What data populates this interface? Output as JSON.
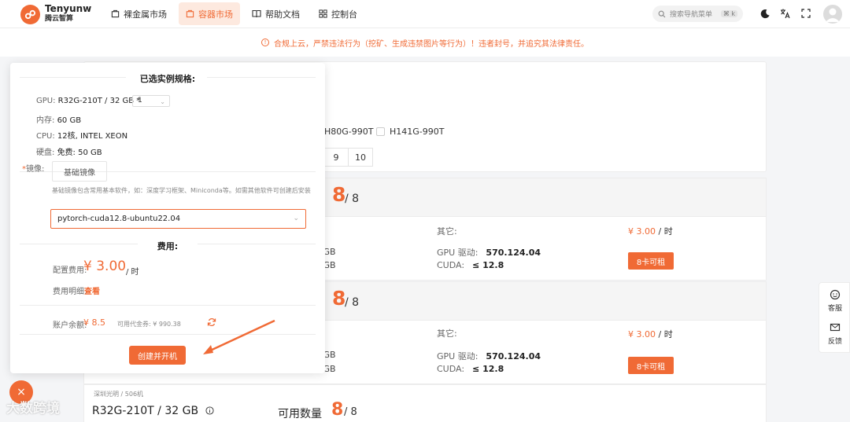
{
  "header": {
    "brand_en": "Tenyunw",
    "brand_cn": "腾云智算",
    "nav": [
      {
        "label": "裸金属市场",
        "icon": "shop-icon"
      },
      {
        "label": "容器市场",
        "icon": "container-icon",
        "active": true
      },
      {
        "label": "帮助文档",
        "icon": "book-icon"
      },
      {
        "label": "控制台",
        "icon": "console-icon"
      }
    ],
    "search_placeholder": "搜索导航菜单",
    "search_shortcut": "⌘ k"
  },
  "notice": "合规上云，严禁违法行为（挖矿、生成违禁图片等行为）！违者封号，并追究其法律责任。",
  "filters": {
    "gpu_options": [
      "H80G-990T",
      "H141G-990T"
    ],
    "pages": [
      "9",
      "10"
    ]
  },
  "listings": [
    {
      "avail_num": "8",
      "avail_den": "/ 8",
      "other_label": "其它:",
      "mem_a": "0 GB",
      "mem_b": "0 GB",
      "driver_label": "GPU 驱动:",
      "driver": "570.124.04",
      "cuda_label": "CUDA:",
      "cuda": "≤ 12.8",
      "price": "¥ 3.00",
      "price_unit": "/ 时",
      "rent": "8卡可租"
    },
    {
      "avail_num": "8",
      "avail_den": "/ 8",
      "other_label": "其它:",
      "mem_a": "0 GB",
      "mem_b": "0 GB",
      "driver_label": "GPU 驱动:",
      "driver": "570.124.04",
      "cuda_label": "CUDA:",
      "cuda": "≤ 12.8",
      "price": "¥ 3.00",
      "price_unit": "/ 时",
      "rent": "8卡可租"
    }
  ],
  "bottom_listing": {
    "sub": "深圳光明 / 506机",
    "title": "R32G-210T / 32 GB",
    "avail_label": "可用数量",
    "avail_num": "8",
    "avail_den": "/ 8"
  },
  "side_float": {
    "service": "客服",
    "feedback": "反馈"
  },
  "popup": {
    "title": "已选实例规格:",
    "gpu_label": "GPU:",
    "gpu_value": "R32G-210T / 32 GB *",
    "gpu_qty": "1",
    "mem_label": "内存:",
    "mem_value": "60 GB",
    "cpu_label": "CPU:",
    "cpu_value": "12核, INTEL XEON",
    "disk_label": "硬盘:",
    "disk_value": "免费: 50 GB",
    "image_label": "镜像:",
    "base_image_tab": "基础镜像",
    "image_desc": "基础镜像包含常用基本软件，如：深度学习框架、Miniconda等。如需其他软件可创建后安装",
    "image_selected": "pytorch-cuda12.8-ubuntu22.04",
    "fee_title": "费用:",
    "config_fee_label": "配置费用:",
    "config_fee": "¥ 3.00",
    "config_fee_unit": "/ 时",
    "fee_detail_label": "费用明细:",
    "fee_detail_link": "查看",
    "balance_label": "账户余额:",
    "balance": "¥ 8.5",
    "coupon": "可用代金券: ¥ 990.38",
    "create_button": "创建并开机"
  },
  "close_icon": "×",
  "watermark": "大数跨境",
  "colors": {
    "accent": "#f06a35"
  }
}
